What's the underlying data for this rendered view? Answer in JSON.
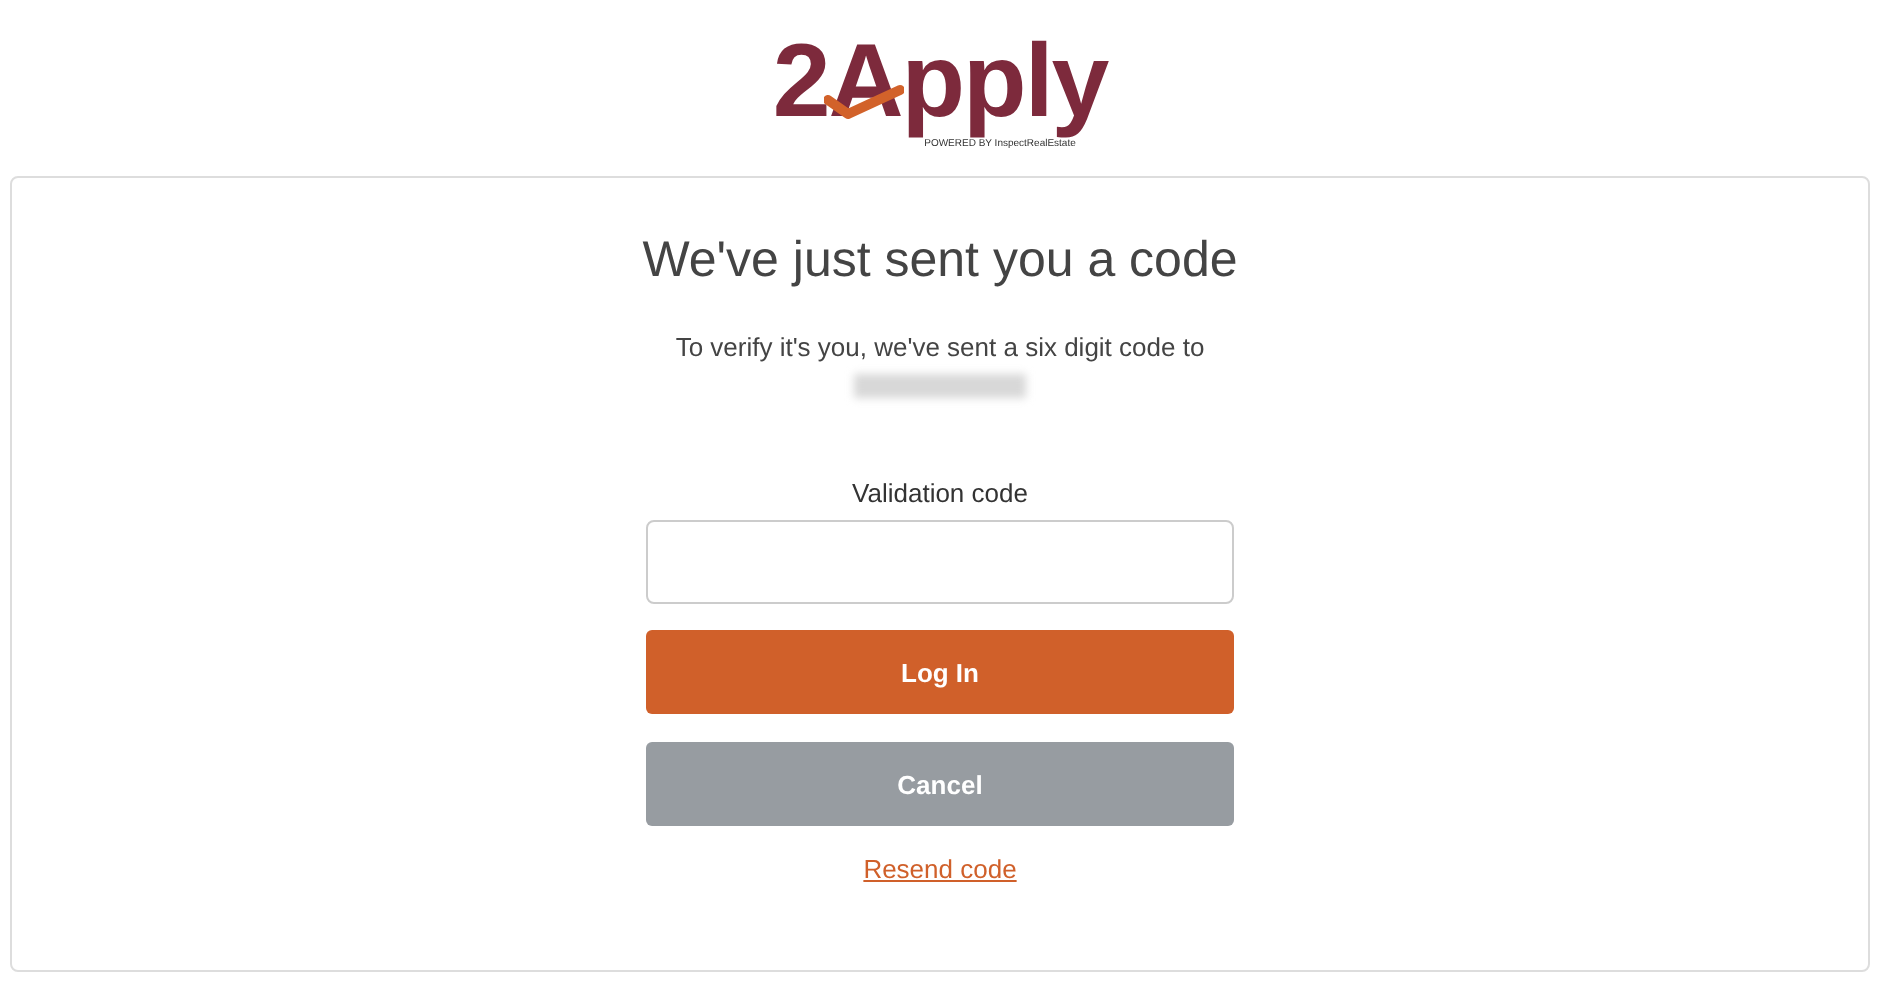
{
  "logo": {
    "text": "2Apply",
    "tagline": "POWERED BY InspectRealEstate"
  },
  "card": {
    "title": "We've just sent you a code",
    "message": "To verify it's you, we've sent a six digit code to",
    "field": {
      "label": "Validation code"
    },
    "buttons": [
      {
        "label": "Log In",
        "kind": "primary"
      },
      {
        "label": "Cancel",
        "kind": "secondary"
      }
    ],
    "link": "Resend code"
  }
}
